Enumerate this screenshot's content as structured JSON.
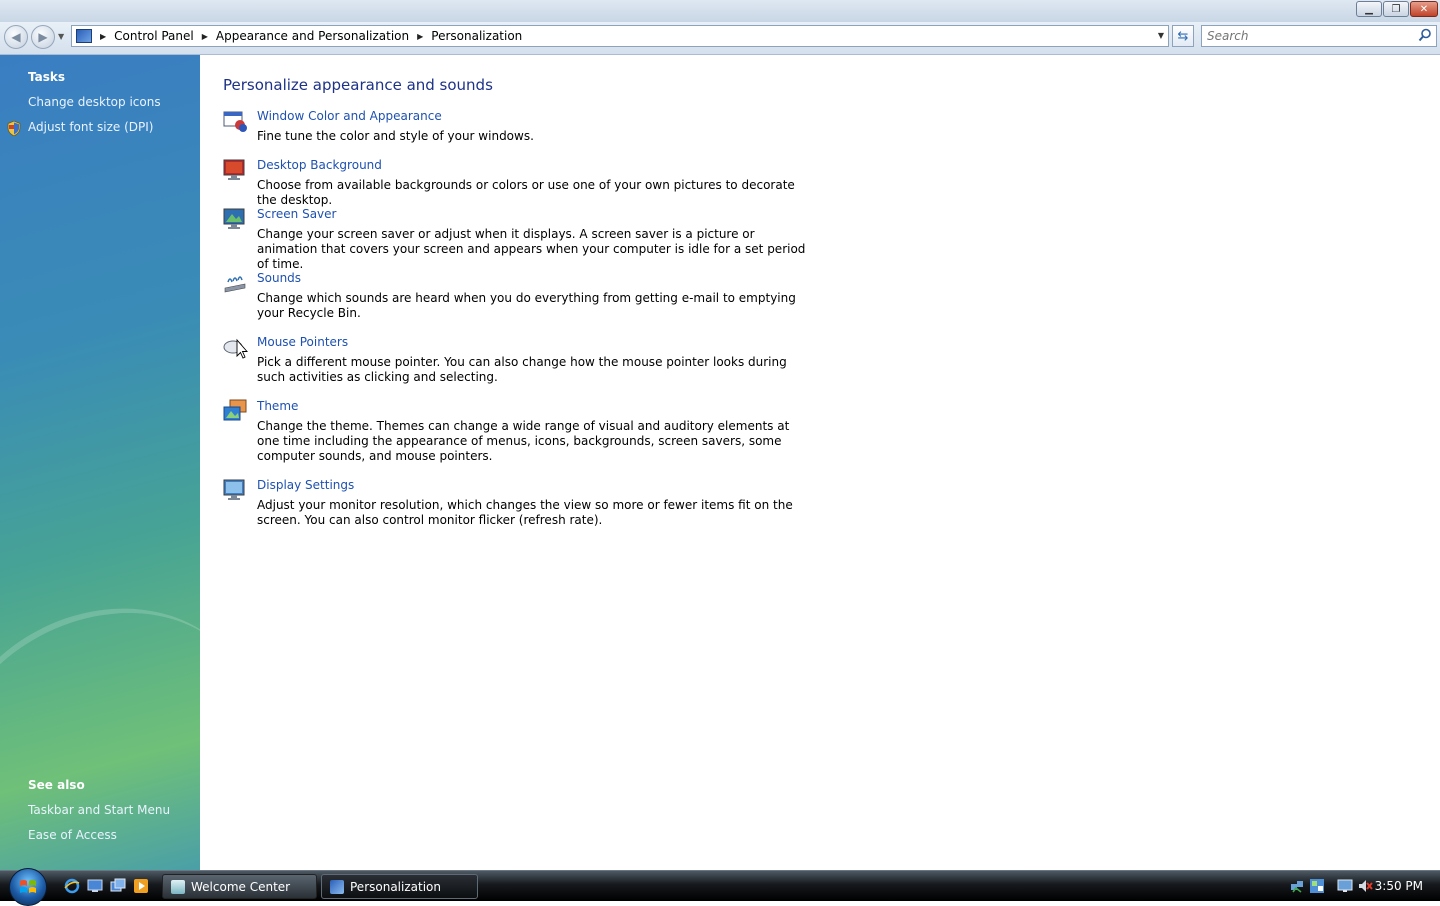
{
  "window": {
    "caption_buttons": [
      "minimize-icon",
      "restore-icon",
      "close-icon"
    ]
  },
  "address": {
    "breadcrumbs": [
      "Control Panel",
      "Appearance and Personalization",
      "Personalization"
    ],
    "search_placeholder": "Search"
  },
  "sidebar": {
    "tasks_heading": "Tasks",
    "tasks": [
      {
        "label": "Change desktop icons"
      },
      {
        "label": "Adjust font size (DPI)",
        "icon": "shield-icon"
      }
    ],
    "see_also_heading": "See also",
    "see_also": [
      {
        "label": "Taskbar and Start Menu"
      },
      {
        "label": "Ease of Access"
      }
    ]
  },
  "main": {
    "title": "Personalize appearance and sounds",
    "items": [
      {
        "title": "Window Color and Appearance",
        "desc": "Fine tune the color and style of your windows.",
        "icon": "window-color-icon"
      },
      {
        "title": "Desktop Background",
        "desc": "Choose from available backgrounds or colors or use one of your own pictures to decorate the desktop.",
        "icon": "desktop-background-icon"
      },
      {
        "title": "Screen Saver",
        "desc": "Change your screen saver or adjust when it displays. A screen saver is a picture or animation that covers your screen and appears when your computer is idle for a set period of time.",
        "icon": "screen-saver-icon"
      },
      {
        "title": "Sounds",
        "desc": "Change which sounds are heard when you do everything from getting e-mail to emptying your Recycle Bin.",
        "icon": "sounds-icon"
      },
      {
        "title": "Mouse Pointers",
        "desc": "Pick a different mouse pointer. You can also change how the mouse pointer looks during such activities as clicking and selecting.",
        "icon": "mouse-pointers-icon"
      },
      {
        "title": "Theme",
        "desc": "Change the theme. Themes can change a wide range of visual and auditory elements at one time including the appearance of menus, icons, backgrounds, screen savers, some computer sounds, and mouse pointers.",
        "icon": "theme-icon"
      },
      {
        "title": "Display Settings",
        "desc": "Adjust your monitor resolution, which changes the view so more or fewer items fit on the screen. You can also control monitor flicker (refresh rate).",
        "icon": "display-settings-icon"
      }
    ]
  },
  "taskbar": {
    "quick_launch": [
      "internet-explorer-icon",
      "show-desktop-icon",
      "switch-windows-icon",
      "media-player-icon"
    ],
    "buttons": [
      {
        "label": "Welcome Center",
        "active": false
      },
      {
        "label": "Personalization",
        "active": true
      }
    ],
    "tray_icons": [
      "network-icon",
      "windows-sidebar-icon",
      "monitor-icon",
      "volume-muted-icon"
    ],
    "clock": "3:50 PM"
  },
  "colors": {
    "link": "#1e51b0",
    "heading": "#1e3287",
    "sidebar_top": "#3a7ec2",
    "sidebar_bottom": "#6fc078"
  }
}
